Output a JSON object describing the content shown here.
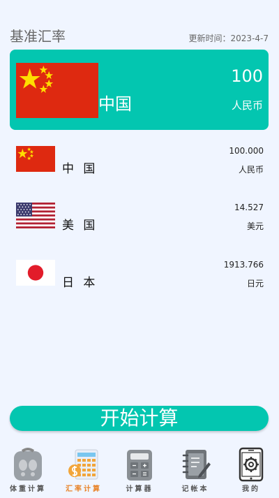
{
  "header": {
    "title": "基准汇率",
    "update_label": "更新时间：",
    "update_date": "2023-4-7"
  },
  "base": {
    "flag": "china-flag",
    "name": "中国",
    "amount": "100",
    "unit": "人民币"
  },
  "rates": [
    {
      "flag": "china-flag",
      "name": "中 国",
      "amount": "100.000",
      "unit": "人民币"
    },
    {
      "flag": "usa-flag",
      "name": "美 国",
      "amount": "14.527",
      "unit": "美元"
    },
    {
      "flag": "japan-flag",
      "name": "日 本",
      "amount": "1913.766",
      "unit": "日元"
    }
  ],
  "start_button": "开始计算",
  "tabs": [
    {
      "icon": "scale-icon",
      "label": "体重计算",
      "active": false
    },
    {
      "icon": "exchange-calculator-icon",
      "label": "汇率计算",
      "active": true
    },
    {
      "icon": "calculator-icon",
      "label": "计算器",
      "active": false
    },
    {
      "icon": "notebook-icon",
      "label": "记帐本",
      "active": false
    },
    {
      "icon": "settings-phone-icon",
      "label": "我的",
      "active": false
    }
  ],
  "colors": {
    "accent": "#03c6b0",
    "background": "#f0f5ff",
    "active_tab": "#e8842a",
    "china_red": "#de2910",
    "china_star": "#ffde00"
  }
}
